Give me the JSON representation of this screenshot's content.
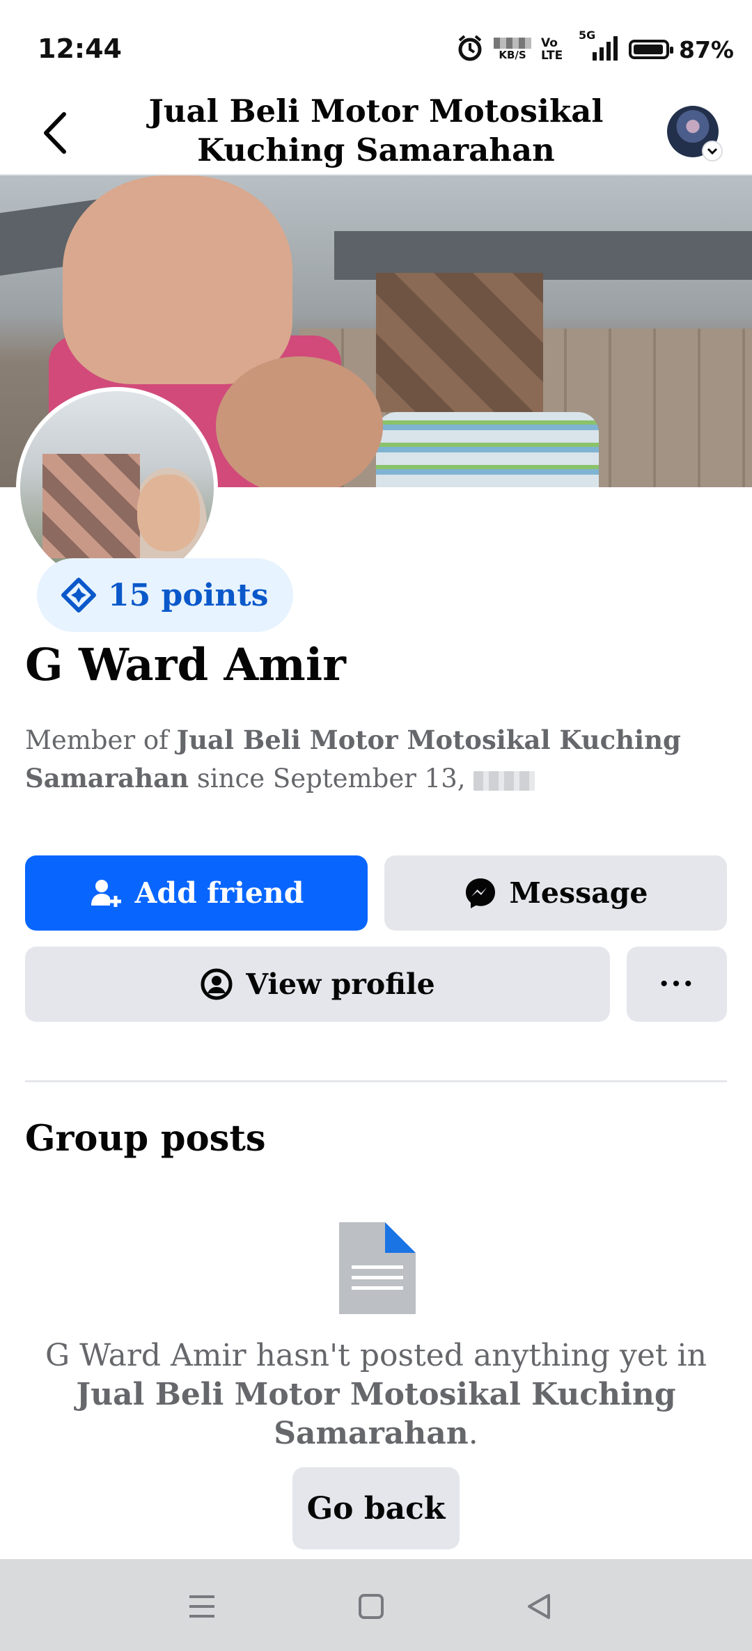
{
  "status_bar": {
    "time": "12:44",
    "network_speed_unit": "KB/S",
    "volte_label": "Vo LTE",
    "network_type": "5G",
    "battery_percent": "87%",
    "icons": [
      "alarm-icon",
      "signal-icon",
      "battery-icon"
    ]
  },
  "header": {
    "title": "Jual Beli Motor Motosikal Kuching Samarahan",
    "back_icon": "back-arrow-icon",
    "avatar_icon": "chevron-down-icon"
  },
  "profile": {
    "points_label": "15 points",
    "name": "G Ward Amir",
    "member_prefix": "Member of ",
    "member_group": "Jual Beli Motor Motosikal Kuching Samarahan",
    "member_since": " since September 13, "
  },
  "actions": {
    "add_friend_label": "Add friend",
    "message_label": "Message",
    "view_profile_label": "View profile",
    "more_label": "···"
  },
  "group_posts": {
    "title": "Group posts",
    "empty_prefix": "G Ward Amir hasn't posted anything yet in ",
    "empty_group": "Jual Beli Motor Motosikal Kuching Samarahan",
    "empty_suffix": ".",
    "go_back_label": "Go back"
  },
  "colors": {
    "primary": "#0866ff",
    "secondary_button": "#e4e6eb",
    "points_bg": "#e7f3ff",
    "points_text": "#0a58ca",
    "muted_text": "#65676b"
  },
  "nav_bar": {
    "buttons": [
      "menu-icon",
      "home-square-icon",
      "back-triangle-icon"
    ]
  }
}
